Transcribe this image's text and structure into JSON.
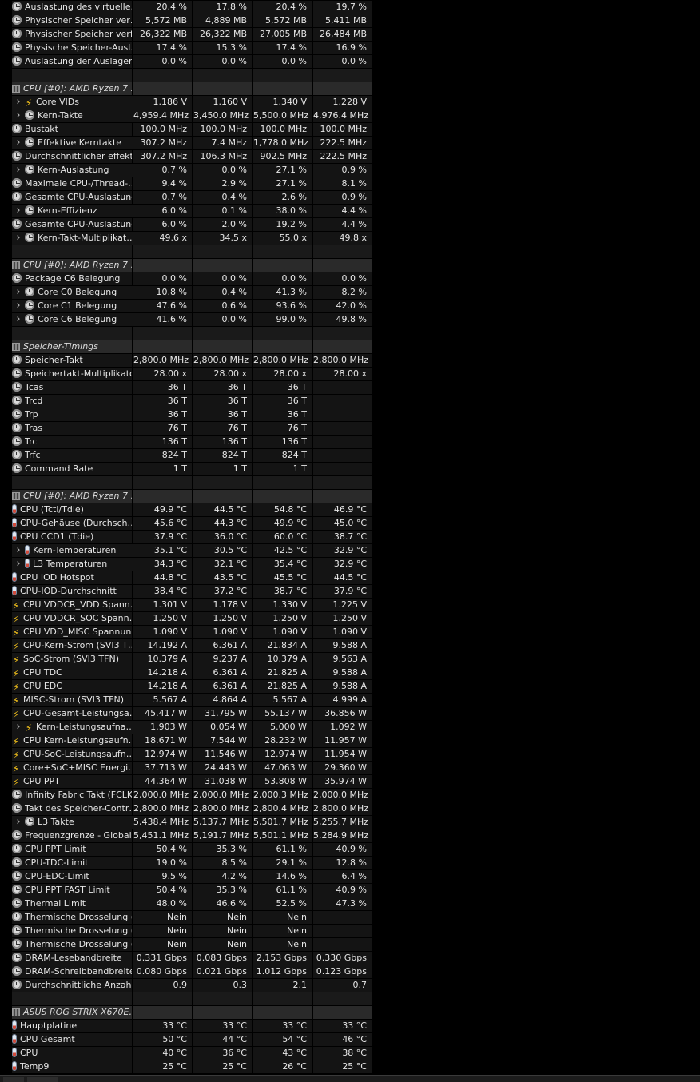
{
  "rows": [
    {
      "type": "data",
      "icon": "clock",
      "name": "Auslastung des virtuelle…",
      "v": [
        "20.4 %",
        "17.8 %",
        "20.4 %",
        "19.7 %"
      ]
    },
    {
      "type": "data",
      "icon": "clock",
      "name": "Physischer Speicher ver…",
      "v": [
        "5,572 MB",
        "4,889 MB",
        "5,572 MB",
        "5,411 MB"
      ]
    },
    {
      "type": "data",
      "icon": "clock",
      "name": "Physischer Speicher verf…",
      "v": [
        "26,322 MB",
        "26,322 MB",
        "27,005 MB",
        "26,484 MB"
      ]
    },
    {
      "type": "data",
      "icon": "clock",
      "name": "Physische Speicher-Ausl…",
      "v": [
        "17.4 %",
        "15.3 %",
        "17.4 %",
        "16.9 %"
      ]
    },
    {
      "type": "data",
      "icon": "clock",
      "name": "Auslastung der Auslager…",
      "v": [
        "0.0 %",
        "0.0 %",
        "0.0 %",
        "0.0 %"
      ]
    },
    {
      "type": "gap"
    },
    {
      "type": "header",
      "name": "CPU [#0]: AMD Ryzen 7 …"
    },
    {
      "type": "data",
      "icon": "bolt",
      "name": "Core VIDs",
      "expand": true,
      "v": [
        "1.186 V",
        "1.160 V",
        "1.340 V",
        "1.228 V"
      ]
    },
    {
      "type": "data",
      "icon": "clock",
      "name": "Kern-Takte",
      "expand": true,
      "v": [
        "4,959.4 MHz",
        "3,450.0 MHz",
        "5,500.0 MHz",
        "4,976.4 MHz"
      ]
    },
    {
      "type": "data",
      "icon": "clock",
      "name": "Bustakt",
      "v": [
        "100.0 MHz",
        "100.0 MHz",
        "100.0 MHz",
        "100.0 MHz"
      ]
    },
    {
      "type": "data",
      "icon": "clock",
      "name": "Effektive Kerntakte",
      "expand": true,
      "v": [
        "307.2 MHz",
        "7.4 MHz",
        "1,778.0 MHz",
        "222.5 MHz"
      ]
    },
    {
      "type": "data",
      "icon": "clock",
      "name": "Durchschnittlicher effekti…",
      "v": [
        "307.2 MHz",
        "106.3 MHz",
        "902.5 MHz",
        "222.5 MHz"
      ]
    },
    {
      "type": "data",
      "icon": "clock",
      "name": "Kern-Auslastung",
      "expand": true,
      "v": [
        "0.7 %",
        "0.0 %",
        "27.1 %",
        "0.9 %"
      ]
    },
    {
      "type": "data",
      "icon": "clock",
      "name": "Maximale CPU-/Thread-…",
      "v": [
        "9.4 %",
        "2.9 %",
        "27.1 %",
        "8.1 %"
      ]
    },
    {
      "type": "data",
      "icon": "clock",
      "name": "Gesamte CPU-Auslastung",
      "v": [
        "0.7 %",
        "0.4 %",
        "2.6 %",
        "0.9 %"
      ]
    },
    {
      "type": "data",
      "icon": "clock",
      "name": "Kern-Effizienz",
      "expand": true,
      "v": [
        "6.0 %",
        "0.1 %",
        "38.0 %",
        "4.4 %"
      ]
    },
    {
      "type": "data",
      "icon": "clock",
      "name": "Gesamte CPU-Auslastung",
      "v": [
        "6.0 %",
        "2.0 %",
        "19.2 %",
        "4.4 %"
      ]
    },
    {
      "type": "data",
      "icon": "clock",
      "name": "Kern-Takt-Multiplikat…",
      "expand": true,
      "v": [
        "49.6 x",
        "34.5 x",
        "55.0 x",
        "49.8 x"
      ]
    },
    {
      "type": "gap"
    },
    {
      "type": "header",
      "name": "CPU [#0]: AMD Ryzen 7 …"
    },
    {
      "type": "data",
      "icon": "clock",
      "name": "Package C6 Belegung",
      "v": [
        "0.0 %",
        "0.0 %",
        "0.0 %",
        "0.0 %"
      ]
    },
    {
      "type": "data",
      "icon": "clock",
      "name": "Core C0 Belegung",
      "expand": true,
      "v": [
        "10.8 %",
        "0.4 %",
        "41.3 %",
        "8.2 %"
      ]
    },
    {
      "type": "data",
      "icon": "clock",
      "name": "Core C1 Belegung",
      "expand": true,
      "v": [
        "47.6 %",
        "0.6 %",
        "93.6 %",
        "42.0 %"
      ]
    },
    {
      "type": "data",
      "icon": "clock",
      "name": "Core C6 Belegung",
      "expand": true,
      "v": [
        "41.6 %",
        "0.0 %",
        "99.0 %",
        "49.8 %"
      ]
    },
    {
      "type": "gap"
    },
    {
      "type": "header",
      "name": "Speicher-Timings"
    },
    {
      "type": "data",
      "icon": "clock",
      "name": "Speicher-Takt",
      "v": [
        "2,800.0 MHz",
        "2,800.0 MHz",
        "2,800.0 MHz",
        "2,800.0 MHz"
      ]
    },
    {
      "type": "data",
      "icon": "clock",
      "name": "Speichertakt-Multiplikator",
      "v": [
        "28.00 x",
        "28.00 x",
        "28.00 x",
        "28.00 x"
      ]
    },
    {
      "type": "data",
      "icon": "clock",
      "name": "Tcas",
      "v": [
        "36 T",
        "36 T",
        "36 T",
        ""
      ]
    },
    {
      "type": "data",
      "icon": "clock",
      "name": "Trcd",
      "v": [
        "36 T",
        "36 T",
        "36 T",
        ""
      ]
    },
    {
      "type": "data",
      "icon": "clock",
      "name": "Trp",
      "v": [
        "36 T",
        "36 T",
        "36 T",
        ""
      ]
    },
    {
      "type": "data",
      "icon": "clock",
      "name": "Tras",
      "v": [
        "76 T",
        "76 T",
        "76 T",
        ""
      ]
    },
    {
      "type": "data",
      "icon": "clock",
      "name": "Trc",
      "v": [
        "136 T",
        "136 T",
        "136 T",
        ""
      ]
    },
    {
      "type": "data",
      "icon": "clock",
      "name": "Trfc",
      "v": [
        "824 T",
        "824 T",
        "824 T",
        ""
      ]
    },
    {
      "type": "data",
      "icon": "clock",
      "name": "Command Rate",
      "v": [
        "1 T",
        "1 T",
        "1 T",
        ""
      ]
    },
    {
      "type": "gap"
    },
    {
      "type": "header",
      "name": "CPU [#0]: AMD Ryzen 7 …"
    },
    {
      "type": "data",
      "icon": "therm",
      "name": "CPU (Tctl/Tdie)",
      "v": [
        "49.9 °C",
        "44.5 °C",
        "54.8 °C",
        "46.9 °C"
      ]
    },
    {
      "type": "data",
      "icon": "therm",
      "name": "CPU-Gehäuse (Durchsch…",
      "v": [
        "45.6 °C",
        "44.3 °C",
        "49.9 °C",
        "45.0 °C"
      ]
    },
    {
      "type": "data",
      "icon": "therm",
      "name": "CPU CCD1 (Tdie)",
      "v": [
        "37.9 °C",
        "36.0 °C",
        "60.0 °C",
        "38.7 °C"
      ]
    },
    {
      "type": "data",
      "icon": "therm",
      "name": "Kern-Temperaturen",
      "expand": true,
      "v": [
        "35.1 °C",
        "30.5 °C",
        "42.5 °C",
        "32.9 °C"
      ]
    },
    {
      "type": "data",
      "icon": "therm",
      "name": "L3 Temperaturen",
      "expand": true,
      "v": [
        "34.3 °C",
        "32.1 °C",
        "35.4 °C",
        "32.9 °C"
      ]
    },
    {
      "type": "data",
      "icon": "therm",
      "name": "CPU IOD Hotspot",
      "v": [
        "44.8 °C",
        "43.5 °C",
        "45.5 °C",
        "44.5 °C"
      ]
    },
    {
      "type": "data",
      "icon": "therm",
      "name": "CPU-IOD-Durchschnitt",
      "v": [
        "38.4 °C",
        "37.2 °C",
        "38.7 °C",
        "37.9 °C"
      ]
    },
    {
      "type": "data",
      "icon": "bolt",
      "name": "CPU VDDCR_VDD Spann…",
      "v": [
        "1.301 V",
        "1.178 V",
        "1.330 V",
        "1.225 V"
      ]
    },
    {
      "type": "data",
      "icon": "bolt",
      "name": "CPU VDDCR_SOC Spann…",
      "v": [
        "1.250 V",
        "1.250 V",
        "1.250 V",
        "1.250 V"
      ]
    },
    {
      "type": "data",
      "icon": "bolt",
      "name": "CPU VDD_MISC Spannun…",
      "v": [
        "1.090 V",
        "1.090 V",
        "1.090 V",
        "1.090 V"
      ]
    },
    {
      "type": "data",
      "icon": "bolt",
      "name": "CPU-Kern-Strom (SVI3 T…",
      "v": [
        "14.192 A",
        "6.361 A",
        "21.834 A",
        "9.588 A"
      ]
    },
    {
      "type": "data",
      "icon": "bolt",
      "name": "SoC-Strom (SVI3 TFN)",
      "v": [
        "10.379 A",
        "9.237 A",
        "10.379 A",
        "9.563 A"
      ]
    },
    {
      "type": "data",
      "icon": "bolt",
      "name": "CPU TDC",
      "v": [
        "14.218 A",
        "6.361 A",
        "21.825 A",
        "9.588 A"
      ]
    },
    {
      "type": "data",
      "icon": "bolt",
      "name": "CPU EDC",
      "v": [
        "14.218 A",
        "6.361 A",
        "21.825 A",
        "9.588 A"
      ]
    },
    {
      "type": "data",
      "icon": "bolt",
      "name": "MISC-Strom (SVI3 TFN)",
      "v": [
        "5.567 A",
        "4.864 A",
        "5.567 A",
        "4.999 A"
      ]
    },
    {
      "type": "data",
      "icon": "bolt",
      "name": "CPU-Gesamt-Leistungsa…",
      "v": [
        "45.417 W",
        "31.795 W",
        "55.137 W",
        "36.856 W"
      ]
    },
    {
      "type": "data",
      "icon": "bolt",
      "name": "Kern-Leistungsaufna…",
      "expand": true,
      "v": [
        "1.903 W",
        "0.054 W",
        "5.000 W",
        "1.092 W"
      ]
    },
    {
      "type": "data",
      "icon": "bolt",
      "name": "CPU Kern-Leistungsaufn…",
      "v": [
        "18.671 W",
        "7.544 W",
        "28.232 W",
        "11.957 W"
      ]
    },
    {
      "type": "data",
      "icon": "bolt",
      "name": "CPU-SoC-Leistungsaufn…",
      "v": [
        "12.974 W",
        "11.546 W",
        "12.974 W",
        "11.954 W"
      ]
    },
    {
      "type": "data",
      "icon": "bolt",
      "name": "Core+SoC+MISC Energi…",
      "v": [
        "37.713 W",
        "24.443 W",
        "47.063 W",
        "29.360 W"
      ]
    },
    {
      "type": "data",
      "icon": "bolt",
      "name": "CPU PPT",
      "v": [
        "44.364 W",
        "31.038 W",
        "53.808 W",
        "35.974 W"
      ]
    },
    {
      "type": "data",
      "icon": "clock",
      "name": "Infinity Fabric Takt (FCLK)",
      "v": [
        "2,000.0 MHz",
        "2,000.0 MHz",
        "2,000.3 MHz",
        "2,000.0 MHz"
      ]
    },
    {
      "type": "data",
      "icon": "clock",
      "name": "Takt des Speicher-Contr…",
      "v": [
        "2,800.0 MHz",
        "2,800.0 MHz",
        "2,800.4 MHz",
        "2,800.0 MHz"
      ]
    },
    {
      "type": "data",
      "icon": "clock",
      "name": "L3 Takte",
      "expand": true,
      "v": [
        "5,438.4 MHz",
        "5,137.7 MHz",
        "5,501.7 MHz",
        "5,255.7 MHz"
      ]
    },
    {
      "type": "data",
      "icon": "clock",
      "name": "Frequenzgrenze - Global",
      "v": [
        "5,451.1 MHz",
        "5,191.7 MHz",
        "5,501.1 MHz",
        "5,284.9 MHz"
      ]
    },
    {
      "type": "data",
      "icon": "clock",
      "name": "CPU PPT Limit",
      "v": [
        "50.4 %",
        "35.3 %",
        "61.1 %",
        "40.9 %"
      ]
    },
    {
      "type": "data",
      "icon": "clock",
      "name": "CPU-TDC-Limit",
      "v": [
        "19.0 %",
        "8.5 %",
        "29.1 %",
        "12.8 %"
      ]
    },
    {
      "type": "data",
      "icon": "clock",
      "name": "CPU-EDC-Limit",
      "v": [
        "9.5 %",
        "4.2 %",
        "14.6 %",
        "6.4 %"
      ]
    },
    {
      "type": "data",
      "icon": "clock",
      "name": "CPU PPT FAST Limit",
      "v": [
        "50.4 %",
        "35.3 %",
        "61.1 %",
        "40.9 %"
      ]
    },
    {
      "type": "data",
      "icon": "clock",
      "name": "Thermal Limit",
      "v": [
        "48.0 %",
        "46.6 %",
        "52.5 %",
        "47.3 %"
      ]
    },
    {
      "type": "data",
      "icon": "clock",
      "name": "Thermische Drosselung (…",
      "v": [
        "Nein",
        "Nein",
        "Nein",
        ""
      ]
    },
    {
      "type": "data",
      "icon": "clock",
      "name": "Thermische Drosselung (…",
      "v": [
        "Nein",
        "Nein",
        "Nein",
        ""
      ]
    },
    {
      "type": "data",
      "icon": "clock",
      "name": "Thermische Drosselung (…",
      "v": [
        "Nein",
        "Nein",
        "Nein",
        ""
      ]
    },
    {
      "type": "data",
      "icon": "clock",
      "name": "DRAM-Lesebandbreite",
      "v": [
        "0.331 Gbps",
        "0.083 Gbps",
        "2.153 Gbps",
        "0.330 Gbps"
      ]
    },
    {
      "type": "data",
      "icon": "clock",
      "name": "DRAM-Schreibbandbreite",
      "v": [
        "0.080 Gbps",
        "0.021 Gbps",
        "1.012 Gbps",
        "0.123 Gbps"
      ]
    },
    {
      "type": "data",
      "icon": "clock",
      "name": "Durchschnittliche Anzahl …",
      "v": [
        "0.9",
        "0.3",
        "2.1",
        "0.7"
      ]
    },
    {
      "type": "gap"
    },
    {
      "type": "header",
      "name": "ASUS ROG STRIX X670E…"
    },
    {
      "type": "data",
      "icon": "therm",
      "name": "Hauptplatine",
      "v": [
        "33 °C",
        "33 °C",
        "33 °C",
        "33 °C"
      ]
    },
    {
      "type": "data",
      "icon": "therm",
      "name": "CPU Gesamt",
      "v": [
        "50 °C",
        "44 °C",
        "54 °C",
        "46 °C"
      ]
    },
    {
      "type": "data",
      "icon": "therm",
      "name": "CPU",
      "v": [
        "40 °C",
        "36 °C",
        "43 °C",
        "38 °C"
      ]
    },
    {
      "type": "data",
      "icon": "therm",
      "name": "Temp9",
      "v": [
        "25 °C",
        "25 °C",
        "26 °C",
        "25 °C"
      ]
    }
  ]
}
